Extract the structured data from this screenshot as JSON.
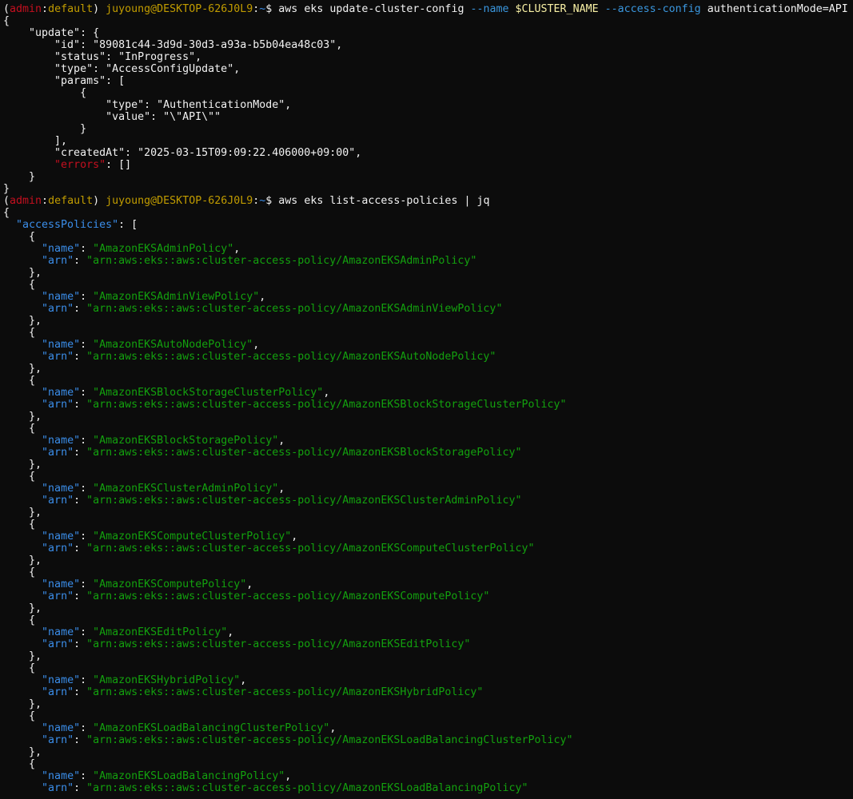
{
  "colors": {
    "background": "#0c0c0c",
    "foreground": "#cccccc",
    "prompt_paren": "#c50f1f",
    "prompt_user": "#c19c00",
    "prompt_path": "#3b8eea",
    "json_key": "#3b8eea",
    "json_string": "#13a10e",
    "flag": "#3a96dd",
    "variable": "#f9f1a5",
    "error_key": "#c50f1f"
  },
  "lines": [
    {
      "segments": [
        {
          "t": "(",
          "c": "c-white"
        },
        {
          "t": "admin",
          "c": "c-red"
        },
        {
          "t": ":",
          "c": "c-white"
        },
        {
          "t": "default",
          "c": "c-yellow"
        },
        {
          "t": ") ",
          "c": "c-white"
        },
        {
          "t": "juyoung@DESKTOP-626J0L9",
          "c": "c-yellow"
        },
        {
          "t": ":",
          "c": "c-white"
        },
        {
          "t": "~",
          "c": "c-blue"
        },
        {
          "t": "$ aws eks update-cluster-config ",
          "c": "c-white"
        },
        {
          "t": "--name ",
          "c": "c-flag"
        },
        {
          "t": "$CLUSTER_NAME ",
          "c": "c-var"
        },
        {
          "t": "--access-config ",
          "c": "c-flag"
        },
        {
          "t": "authenticationMode=API",
          "c": "c-white"
        }
      ]
    },
    {
      "segments": [
        {
          "t": "{",
          "c": "c-white"
        }
      ]
    },
    {
      "segments": [
        {
          "t": "    \"update\": {",
          "c": "c-white"
        }
      ]
    },
    {
      "segments": [
        {
          "t": "        \"id\": \"89081c44-3d9d-30d3-a93a-b5b04ea48c03\",",
          "c": "c-white"
        }
      ]
    },
    {
      "segments": [
        {
          "t": "        \"status\": \"InProgress\",",
          "c": "c-white"
        }
      ]
    },
    {
      "segments": [
        {
          "t": "        \"type\": \"AccessConfigUpdate\",",
          "c": "c-white"
        }
      ]
    },
    {
      "segments": [
        {
          "t": "        \"params\": [",
          "c": "c-white"
        }
      ]
    },
    {
      "segments": [
        {
          "t": "            {",
          "c": "c-white"
        }
      ]
    },
    {
      "segments": [
        {
          "t": "                \"type\": \"AuthenticationMode\",",
          "c": "c-white"
        }
      ]
    },
    {
      "segments": [
        {
          "t": "                \"value\": \"\\\"API\\\"\"",
          "c": "c-white"
        }
      ]
    },
    {
      "segments": [
        {
          "t": "            }",
          "c": "c-white"
        }
      ]
    },
    {
      "segments": [
        {
          "t": "        ],",
          "c": "c-white"
        }
      ]
    },
    {
      "segments": [
        {
          "t": "        \"createdAt\": \"2025-03-15T09:09:22.406000+09:00\",",
          "c": "c-white"
        }
      ]
    },
    {
      "segments": [
        {
          "t": "        ",
          "c": "c-white"
        },
        {
          "t": "\"errors\"",
          "c": "c-red"
        },
        {
          "t": ": []",
          "c": "c-white"
        }
      ]
    },
    {
      "segments": [
        {
          "t": "    }",
          "c": "c-white"
        }
      ]
    },
    {
      "segments": [
        {
          "t": "}",
          "c": "c-white"
        }
      ]
    },
    {
      "segments": [
        {
          "t": "(",
          "c": "c-white"
        },
        {
          "t": "admin",
          "c": "c-red"
        },
        {
          "t": ":",
          "c": "c-white"
        },
        {
          "t": "default",
          "c": "c-yellow"
        },
        {
          "t": ") ",
          "c": "c-white"
        },
        {
          "t": "juyoung@DESKTOP-626J0L9",
          "c": "c-yellow"
        },
        {
          "t": ":",
          "c": "c-white"
        },
        {
          "t": "~",
          "c": "c-blue"
        },
        {
          "t": "$ aws eks list-access-policies | jq",
          "c": "c-white"
        }
      ]
    },
    {
      "segments": [
        {
          "t": "{",
          "c": "c-white"
        }
      ]
    },
    {
      "segments": [
        {
          "t": "  ",
          "c": "c-white"
        },
        {
          "t": "\"accessPolicies\"",
          "c": "c-key"
        },
        {
          "t": ": [",
          "c": "c-white"
        }
      ]
    },
    {
      "segments": [
        {
          "t": "    {",
          "c": "c-white"
        }
      ]
    },
    {
      "segments": [
        {
          "t": "      ",
          "c": "c-white"
        },
        {
          "t": "\"name\"",
          "c": "c-key"
        },
        {
          "t": ": ",
          "c": "c-white"
        },
        {
          "t": "\"AmazonEKSAdminPolicy\"",
          "c": "c-str"
        },
        {
          "t": ",",
          "c": "c-white"
        }
      ]
    },
    {
      "segments": [
        {
          "t": "      ",
          "c": "c-white"
        },
        {
          "t": "\"arn\"",
          "c": "c-key"
        },
        {
          "t": ": ",
          "c": "c-white"
        },
        {
          "t": "\"arn:aws:eks::aws:cluster-access-policy/AmazonEKSAdminPolicy\"",
          "c": "c-str"
        }
      ]
    },
    {
      "segments": [
        {
          "t": "    },",
          "c": "c-white"
        }
      ]
    },
    {
      "segments": [
        {
          "t": "    {",
          "c": "c-white"
        }
      ]
    },
    {
      "segments": [
        {
          "t": "      ",
          "c": "c-white"
        },
        {
          "t": "\"name\"",
          "c": "c-key"
        },
        {
          "t": ": ",
          "c": "c-white"
        },
        {
          "t": "\"AmazonEKSAdminViewPolicy\"",
          "c": "c-str"
        },
        {
          "t": ",",
          "c": "c-white"
        }
      ]
    },
    {
      "segments": [
        {
          "t": "      ",
          "c": "c-white"
        },
        {
          "t": "\"arn\"",
          "c": "c-key"
        },
        {
          "t": ": ",
          "c": "c-white"
        },
        {
          "t": "\"arn:aws:eks::aws:cluster-access-policy/AmazonEKSAdminViewPolicy\"",
          "c": "c-str"
        }
      ]
    },
    {
      "segments": [
        {
          "t": "    },",
          "c": "c-white"
        }
      ]
    },
    {
      "segments": [
        {
          "t": "    {",
          "c": "c-white"
        }
      ]
    },
    {
      "segments": [
        {
          "t": "      ",
          "c": "c-white"
        },
        {
          "t": "\"name\"",
          "c": "c-key"
        },
        {
          "t": ": ",
          "c": "c-white"
        },
        {
          "t": "\"AmazonEKSAutoNodePolicy\"",
          "c": "c-str"
        },
        {
          "t": ",",
          "c": "c-white"
        }
      ]
    },
    {
      "segments": [
        {
          "t": "      ",
          "c": "c-white"
        },
        {
          "t": "\"arn\"",
          "c": "c-key"
        },
        {
          "t": ": ",
          "c": "c-white"
        },
        {
          "t": "\"arn:aws:eks::aws:cluster-access-policy/AmazonEKSAutoNodePolicy\"",
          "c": "c-str"
        }
      ]
    },
    {
      "segments": [
        {
          "t": "    },",
          "c": "c-white"
        }
      ]
    },
    {
      "segments": [
        {
          "t": "    {",
          "c": "c-white"
        }
      ]
    },
    {
      "segments": [
        {
          "t": "      ",
          "c": "c-white"
        },
        {
          "t": "\"name\"",
          "c": "c-key"
        },
        {
          "t": ": ",
          "c": "c-white"
        },
        {
          "t": "\"AmazonEKSBlockStorageClusterPolicy\"",
          "c": "c-str"
        },
        {
          "t": ",",
          "c": "c-white"
        }
      ]
    },
    {
      "segments": [
        {
          "t": "      ",
          "c": "c-white"
        },
        {
          "t": "\"arn\"",
          "c": "c-key"
        },
        {
          "t": ": ",
          "c": "c-white"
        },
        {
          "t": "\"arn:aws:eks::aws:cluster-access-policy/AmazonEKSBlockStorageClusterPolicy\"",
          "c": "c-str"
        }
      ]
    },
    {
      "segments": [
        {
          "t": "    },",
          "c": "c-white"
        }
      ]
    },
    {
      "segments": [
        {
          "t": "    {",
          "c": "c-white"
        }
      ]
    },
    {
      "segments": [
        {
          "t": "      ",
          "c": "c-white"
        },
        {
          "t": "\"name\"",
          "c": "c-key"
        },
        {
          "t": ": ",
          "c": "c-white"
        },
        {
          "t": "\"AmazonEKSBlockStoragePolicy\"",
          "c": "c-str"
        },
        {
          "t": ",",
          "c": "c-white"
        }
      ]
    },
    {
      "segments": [
        {
          "t": "      ",
          "c": "c-white"
        },
        {
          "t": "\"arn\"",
          "c": "c-key"
        },
        {
          "t": ": ",
          "c": "c-white"
        },
        {
          "t": "\"arn:aws:eks::aws:cluster-access-policy/AmazonEKSBlockStoragePolicy\"",
          "c": "c-str"
        }
      ]
    },
    {
      "segments": [
        {
          "t": "    },",
          "c": "c-white"
        }
      ]
    },
    {
      "segments": [
        {
          "t": "    {",
          "c": "c-white"
        }
      ]
    },
    {
      "segments": [
        {
          "t": "      ",
          "c": "c-white"
        },
        {
          "t": "\"name\"",
          "c": "c-key"
        },
        {
          "t": ": ",
          "c": "c-white"
        },
        {
          "t": "\"AmazonEKSClusterAdminPolicy\"",
          "c": "c-str"
        },
        {
          "t": ",",
          "c": "c-white"
        }
      ]
    },
    {
      "segments": [
        {
          "t": "      ",
          "c": "c-white"
        },
        {
          "t": "\"arn\"",
          "c": "c-key"
        },
        {
          "t": ": ",
          "c": "c-white"
        },
        {
          "t": "\"arn:aws:eks::aws:cluster-access-policy/AmazonEKSClusterAdminPolicy\"",
          "c": "c-str"
        }
      ]
    },
    {
      "segments": [
        {
          "t": "    },",
          "c": "c-white"
        }
      ]
    },
    {
      "segments": [
        {
          "t": "    {",
          "c": "c-white"
        }
      ]
    },
    {
      "segments": [
        {
          "t": "      ",
          "c": "c-white"
        },
        {
          "t": "\"name\"",
          "c": "c-key"
        },
        {
          "t": ": ",
          "c": "c-white"
        },
        {
          "t": "\"AmazonEKSComputeClusterPolicy\"",
          "c": "c-str"
        },
        {
          "t": ",",
          "c": "c-white"
        }
      ]
    },
    {
      "segments": [
        {
          "t": "      ",
          "c": "c-white"
        },
        {
          "t": "\"arn\"",
          "c": "c-key"
        },
        {
          "t": ": ",
          "c": "c-white"
        },
        {
          "t": "\"arn:aws:eks::aws:cluster-access-policy/AmazonEKSComputeClusterPolicy\"",
          "c": "c-str"
        }
      ]
    },
    {
      "segments": [
        {
          "t": "    },",
          "c": "c-white"
        }
      ]
    },
    {
      "segments": [
        {
          "t": "    {",
          "c": "c-white"
        }
      ]
    },
    {
      "segments": [
        {
          "t": "      ",
          "c": "c-white"
        },
        {
          "t": "\"name\"",
          "c": "c-key"
        },
        {
          "t": ": ",
          "c": "c-white"
        },
        {
          "t": "\"AmazonEKSComputePolicy\"",
          "c": "c-str"
        },
        {
          "t": ",",
          "c": "c-white"
        }
      ]
    },
    {
      "segments": [
        {
          "t": "      ",
          "c": "c-white"
        },
        {
          "t": "\"arn\"",
          "c": "c-key"
        },
        {
          "t": ": ",
          "c": "c-white"
        },
        {
          "t": "\"arn:aws:eks::aws:cluster-access-policy/AmazonEKSComputePolicy\"",
          "c": "c-str"
        }
      ]
    },
    {
      "segments": [
        {
          "t": "    },",
          "c": "c-white"
        }
      ]
    },
    {
      "segments": [
        {
          "t": "    {",
          "c": "c-white"
        }
      ]
    },
    {
      "segments": [
        {
          "t": "      ",
          "c": "c-white"
        },
        {
          "t": "\"name\"",
          "c": "c-key"
        },
        {
          "t": ": ",
          "c": "c-white"
        },
        {
          "t": "\"AmazonEKSEditPolicy\"",
          "c": "c-str"
        },
        {
          "t": ",",
          "c": "c-white"
        }
      ]
    },
    {
      "segments": [
        {
          "t": "      ",
          "c": "c-white"
        },
        {
          "t": "\"arn\"",
          "c": "c-key"
        },
        {
          "t": ": ",
          "c": "c-white"
        },
        {
          "t": "\"arn:aws:eks::aws:cluster-access-policy/AmazonEKSEditPolicy\"",
          "c": "c-str"
        }
      ]
    },
    {
      "segments": [
        {
          "t": "    },",
          "c": "c-white"
        }
      ]
    },
    {
      "segments": [
        {
          "t": "    {",
          "c": "c-white"
        }
      ]
    },
    {
      "segments": [
        {
          "t": "      ",
          "c": "c-white"
        },
        {
          "t": "\"name\"",
          "c": "c-key"
        },
        {
          "t": ": ",
          "c": "c-white"
        },
        {
          "t": "\"AmazonEKSHybridPolicy\"",
          "c": "c-str"
        },
        {
          "t": ",",
          "c": "c-white"
        }
      ]
    },
    {
      "segments": [
        {
          "t": "      ",
          "c": "c-white"
        },
        {
          "t": "\"arn\"",
          "c": "c-key"
        },
        {
          "t": ": ",
          "c": "c-white"
        },
        {
          "t": "\"arn:aws:eks::aws:cluster-access-policy/AmazonEKSHybridPolicy\"",
          "c": "c-str"
        }
      ]
    },
    {
      "segments": [
        {
          "t": "    },",
          "c": "c-white"
        }
      ]
    },
    {
      "segments": [
        {
          "t": "    {",
          "c": "c-white"
        }
      ]
    },
    {
      "segments": [
        {
          "t": "      ",
          "c": "c-white"
        },
        {
          "t": "\"name\"",
          "c": "c-key"
        },
        {
          "t": ": ",
          "c": "c-white"
        },
        {
          "t": "\"AmazonEKSLoadBalancingClusterPolicy\"",
          "c": "c-str"
        },
        {
          "t": ",",
          "c": "c-white"
        }
      ]
    },
    {
      "segments": [
        {
          "t": "      ",
          "c": "c-white"
        },
        {
          "t": "\"arn\"",
          "c": "c-key"
        },
        {
          "t": ": ",
          "c": "c-white"
        },
        {
          "t": "\"arn:aws:eks::aws:cluster-access-policy/AmazonEKSLoadBalancingClusterPolicy\"",
          "c": "c-str"
        }
      ]
    },
    {
      "segments": [
        {
          "t": "    },",
          "c": "c-white"
        }
      ]
    },
    {
      "segments": [
        {
          "t": "    {",
          "c": "c-white"
        }
      ]
    },
    {
      "segments": [
        {
          "t": "      ",
          "c": "c-white"
        },
        {
          "t": "\"name\"",
          "c": "c-key"
        },
        {
          "t": ": ",
          "c": "c-white"
        },
        {
          "t": "\"AmazonEKSLoadBalancingPolicy\"",
          "c": "c-str"
        },
        {
          "t": ",",
          "c": "c-white"
        }
      ]
    },
    {
      "segments": [
        {
          "t": "      ",
          "c": "c-white"
        },
        {
          "t": "\"arn\"",
          "c": "c-key"
        },
        {
          "t": ": ",
          "c": "c-white"
        },
        {
          "t": "\"arn:aws:eks::aws:cluster-access-policy/AmazonEKSLoadBalancingPolicy\"",
          "c": "c-str"
        }
      ]
    }
  ]
}
